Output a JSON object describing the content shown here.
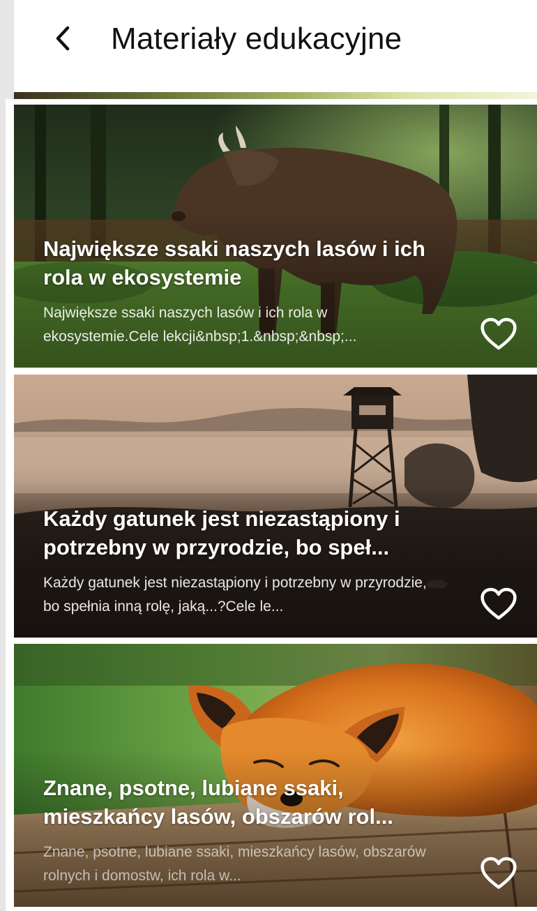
{
  "header": {
    "title": "Materiały edukacyjne"
  },
  "cards": [
    {
      "title": "Największe ssaki naszych lasów i ich rola w ekosystemie",
      "description": "Największe ssaki naszych lasów i ich rola w ekosystemie.Cele lekcji&nbsp;1.&nbsp;&nbsp;..."
    },
    {
      "title": "Każdy gatunek jest niezastąpiony i potrzebny w przyrodzie, bo speł...",
      "description": "Każdy gatunek jest niezastąpiony i potrzebny w przyrodzie, bo spełnia inną rolę, jaką...?Cele le..."
    },
    {
      "title": "Znane, psotne, lubiane ssaki, mieszkańcy lasów, obszarów rol...",
      "description": "Znane, psotne, lubiane ssaki, mieszkańcy lasów, obszarów rolnych i domostw, ich rola w..."
    }
  ]
}
